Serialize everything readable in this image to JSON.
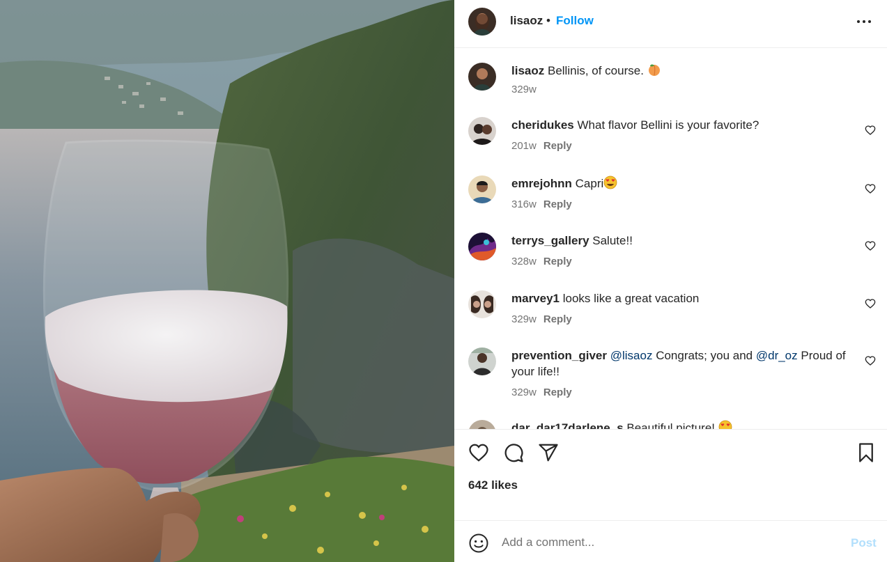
{
  "post": {
    "author": {
      "username": "lisaoz",
      "follow_label": "Follow",
      "separator": "•"
    },
    "caption": {
      "username": "lisaoz",
      "text": "Bellinis, of course.",
      "emoji": "peach-emoji",
      "time": "329w"
    },
    "comments": [
      {
        "username": "cheridukes",
        "text": "What flavor Bellini is your favorite?",
        "time": "201w",
        "reply_label": "Reply"
      },
      {
        "username": "emrejohnn",
        "text": "Capri",
        "emoji": "heart-eyes-emoji",
        "time": "316w",
        "reply_label": "Reply"
      },
      {
        "username": "terrys_gallery",
        "text": "Salute!!",
        "time": "328w",
        "reply_label": "Reply"
      },
      {
        "username": "marvey1",
        "text": "looks like a great vacation",
        "time": "329w",
        "reply_label": "Reply"
      },
      {
        "username": "prevention_giver",
        "mention1": "@lisaoz",
        "text1": "Congrats; you and",
        "mention2": "@dr_oz",
        "text2": "Proud of your life!!",
        "time": "329w",
        "reply_label": "Reply"
      },
      {
        "username": "dar_dar17darlene_s",
        "text": "Beautiful picture!",
        "emoji": "heart-eyes-emoji"
      }
    ],
    "likes_label": "642 likes",
    "composer": {
      "placeholder": "Add a comment...",
      "post_label": "Post"
    },
    "colors": {
      "link": "#0095f6",
      "mention": "#00376b",
      "muted": "#737373",
      "post_disabled": "#b2dffc"
    }
  }
}
